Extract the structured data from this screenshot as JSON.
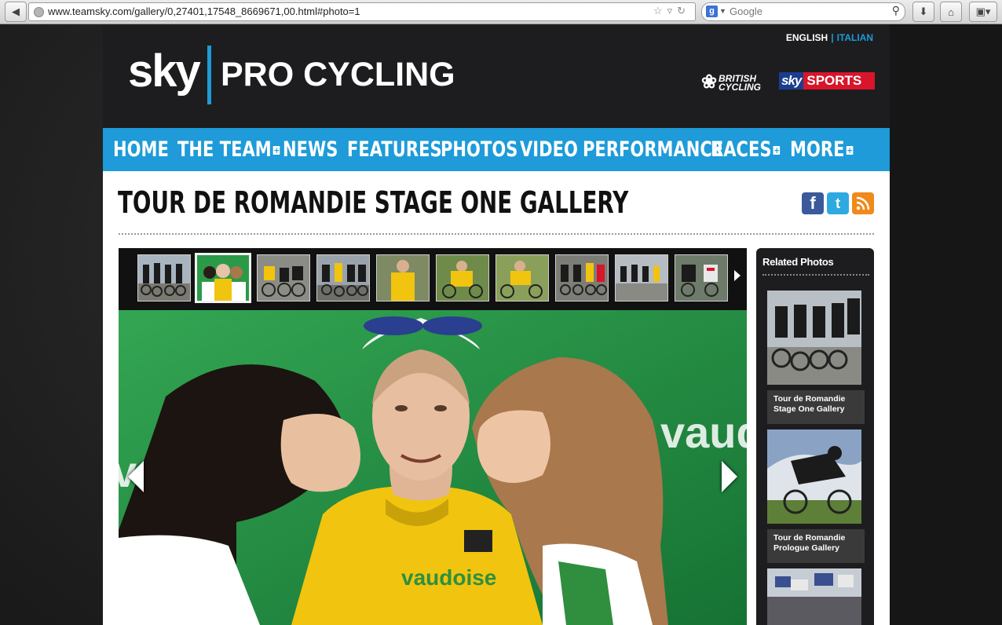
{
  "browser": {
    "url": "www.teamsky.com/gallery/0,27401,17548_8669671,00.html#photo=1",
    "search_placeholder": "Google",
    "search_engine_badge": "g"
  },
  "site": {
    "logo_sky": "sky",
    "logo_product": "PRO CYCLING",
    "lang_english": "ENGLISH",
    "lang_italian": "ITALIAN",
    "partner_bc": "BRITISH CYCLING",
    "partner_ss_sky": "sky",
    "partner_ss_sports": "SPORTS"
  },
  "nav": {
    "items": [
      {
        "label": "HOME",
        "has_submenu": false
      },
      {
        "label": "THE TEAM",
        "has_submenu": true
      },
      {
        "label": "NEWS",
        "has_submenu": false
      },
      {
        "label": "FEATURES",
        "has_submenu": false
      },
      {
        "label": "PHOTOS",
        "has_submenu": false
      },
      {
        "label": "VIDEO",
        "has_submenu": false
      },
      {
        "label": "PERFORMANCE",
        "has_submenu": false
      },
      {
        "label": "RACES",
        "has_submenu": true
      },
      {
        "label": "MORE",
        "has_submenu": true
      }
    ]
  },
  "page": {
    "title": "TOUR DE ROMANDIE STAGE ONE GALLERY",
    "social": {
      "facebook": "f",
      "twitter": "t",
      "rss": "rss"
    }
  },
  "gallery": {
    "current_photo": 1,
    "thumb_count": 10,
    "photo_banner_text": "vaudoise"
  },
  "related": {
    "title": "Related Photos",
    "items": [
      {
        "caption": "Tour de Romandie Stage One Gallery"
      },
      {
        "caption": "Tour de Romandie Prologue Gallery"
      },
      {
        "caption": ""
      }
    ]
  },
  "colors": {
    "brand_blue": "#1e9bd8",
    "header_dark": "#1d1d1f",
    "jersey_yellow": "#f1c40f",
    "podium_green": "#1e8a3e"
  }
}
